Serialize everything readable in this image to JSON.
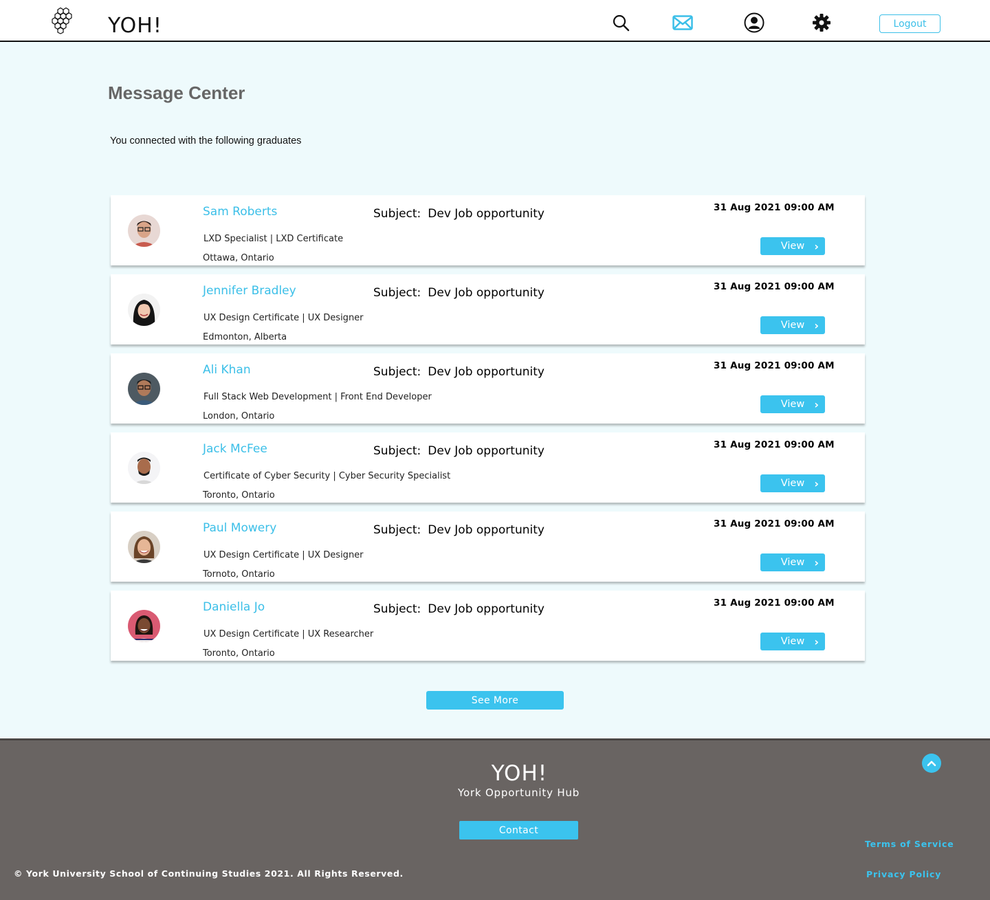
{
  "header": {
    "logo_text": "YOH!",
    "logout_label": "Logout",
    "icons": [
      "hexagon-logo-icon",
      "search-icon",
      "mail-icon",
      "user-icon",
      "gear-icon"
    ],
    "accent_color": "#3bbfe8"
  },
  "main": {
    "title": "Message Center",
    "intro": "You connected with the following graduates",
    "subject_label": "Subject:",
    "view_label": "View",
    "see_more_label": "See More",
    "messages": [
      {
        "name": "Sam Roberts",
        "credentials": "LXD Specialist | LXD Certificate",
        "location": "Ottawa, Ontario",
        "subject": "Dev Job opportunity",
        "date": "31 Aug 2021 09:00 AM"
      },
      {
        "name": "Jennifer Bradley",
        "credentials": "UX Design Certificate | UX Designer",
        "location": "Edmonton, Alberta",
        "subject": "Dev Job opportunity",
        "date": "31 Aug 2021 09:00 AM"
      },
      {
        "name": "Ali Khan",
        "credentials": "Full Stack Web Development | Front End Developer",
        "location": "London, Ontario",
        "subject": "Dev Job opportunity",
        "date": "31 Aug 2021 09:00 AM"
      },
      {
        "name": "Jack McFee",
        "credentials": "Certificate of Cyber Security | Cyber Security Specialist",
        "location": "Toronto, Ontario",
        "subject": "Dev Job opportunity",
        "date": "31 Aug 2021 09:00 AM"
      },
      {
        "name": "Paul Mowery",
        "credentials": "UX Design Certificate | UX Designer",
        "location": "Tornoto, Ontario",
        "subject": "Dev Job opportunity",
        "date": "31 Aug 2021 09:00 AM"
      },
      {
        "name": "Daniella Jo",
        "credentials": "UX Design Certificate | UX Researcher",
        "location": "Toronto, Ontario",
        "subject": "Dev Job opportunity",
        "date": "31 Aug 2021 09:00 AM"
      }
    ]
  },
  "footer": {
    "logo_text": "YOH!",
    "tagline": "York Opportunity Hub",
    "contact_label": "Contact",
    "terms_label": "Terms of Service",
    "privacy_label": "Privacy Policy",
    "copyright": "© York University School of Continuing Studies 2021. All Rights Reserved."
  }
}
